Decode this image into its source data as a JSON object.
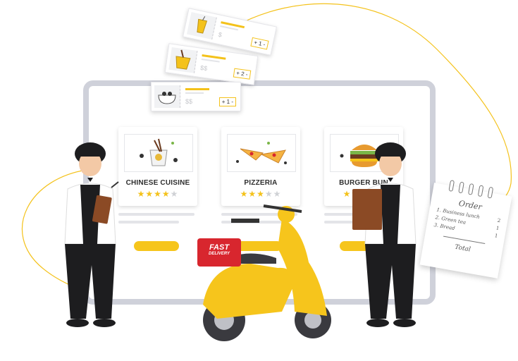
{
  "cards": [
    {
      "title": "CHINESE CUISINE",
      "rating": 4,
      "icon": "noodle-box-icon"
    },
    {
      "title": "PIZZERIA",
      "rating": 3,
      "icon": "pizza-icon"
    },
    {
      "title": "BURGER BUN",
      "rating": 3,
      "icon": "burger-icon"
    }
  ],
  "tickets": [
    {
      "price": "$",
      "qty": "+ 1 -",
      "icon": "drink-cup-icon"
    },
    {
      "price": "$$",
      "qty": "+ 2 -",
      "icon": "takeout-box-icon"
    },
    {
      "price": "$$",
      "qty": "+ 1 -",
      "icon": "bowl-icon"
    }
  ],
  "delivery_box": {
    "line1": "FAST",
    "line2": "DELIVERY"
  },
  "order_note": {
    "heading": "Order",
    "items": [
      "1. Business lunch",
      "2. Green tea",
      "3. Bread"
    ],
    "quantities": [
      "2",
      "1",
      "1"
    ],
    "total_label": "Total"
  },
  "colors": {
    "accent": "#f6c51c",
    "frame": "#cfd1da",
    "delivery_red": "#d8262e"
  }
}
